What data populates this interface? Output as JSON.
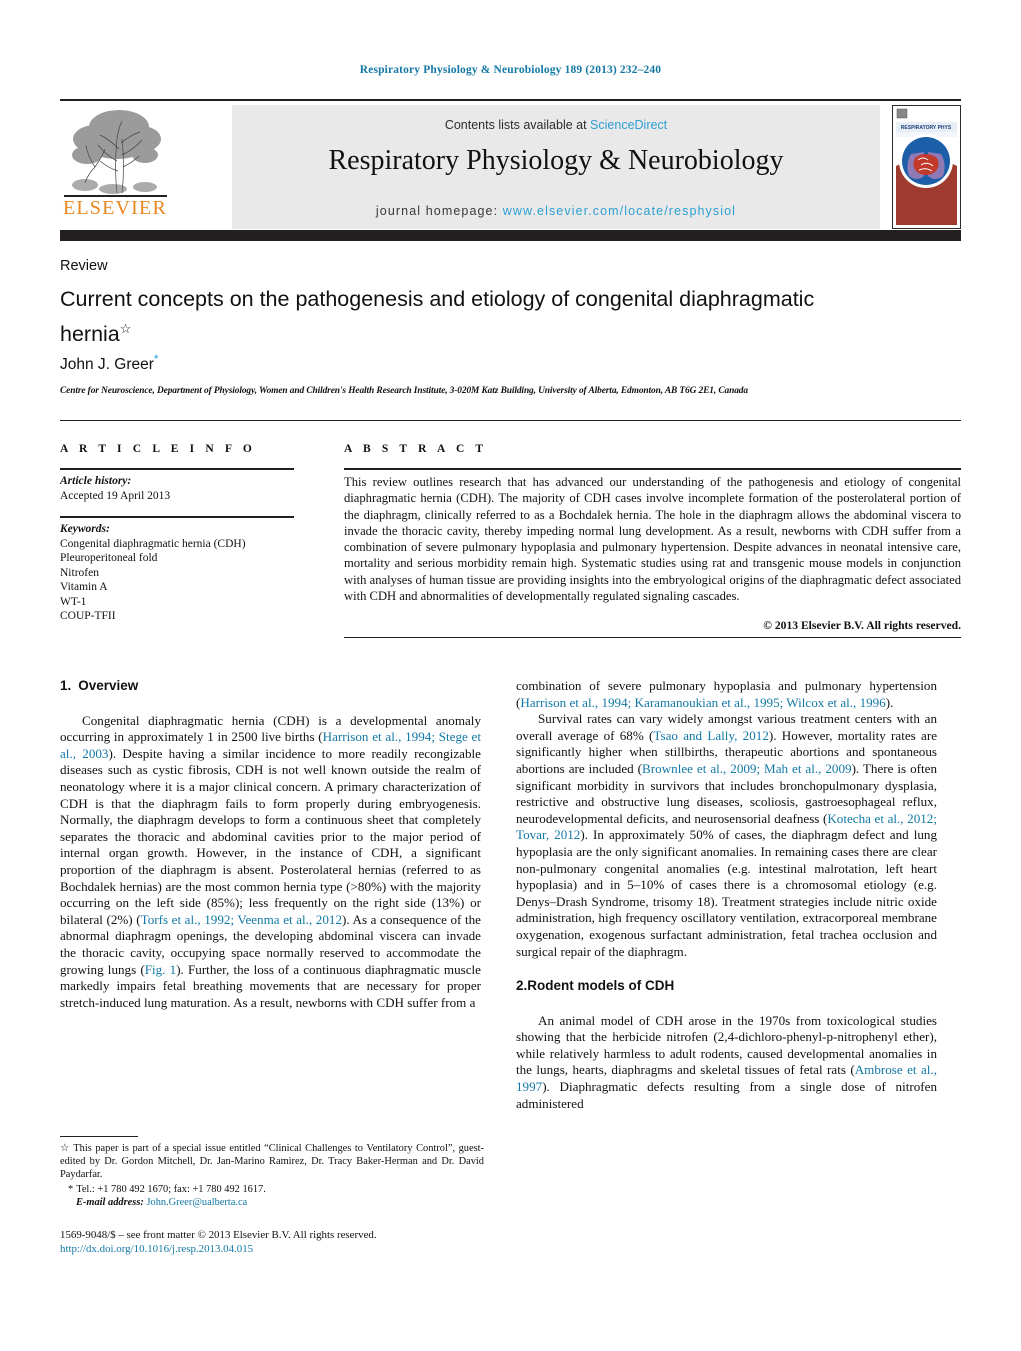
{
  "running_head": "Respiratory Physiology & Neurobiology 189 (2013) 232–240",
  "masthead": {
    "contents_prefix": "Contents lists available at ",
    "contents_link": "ScienceDirect",
    "journal_name": "Respiratory Physiology & Neurobiology",
    "homepage_label": "journal homepage: ",
    "homepage_url": "www.elsevier.com/locate/resphysiol",
    "publisher_logo_text": "ELSEVIER",
    "publisher_logo_icon": "elsevier-tree-icon",
    "cover_thumbnail_icon": "journal-cover-thumbnail",
    "cover_title_text": "RESPIRATORY PHYSIOLOGY & NEUROBIOLOGY",
    "accent_link_color": "#2e9fd4",
    "band_color": "#231f20"
  },
  "article": {
    "doctype": "Review",
    "title": "Current concepts on the pathogenesis and etiology of congenital diaphragmatic hernia",
    "title_marker": "☆",
    "author": "John J. Greer",
    "author_marker": "*",
    "affiliation": "Centre for Neuroscience, Department of Physiology, Women and Children's Health Research Institute, 3-020M Katz Building, University of Alberta, Edmonton, AB T6G 2E1, Canada"
  },
  "article_info": {
    "heading": "A R T I C L E   I N F O",
    "history_label": "Article history:",
    "history_value": "Accepted 19 April 2013",
    "keywords_label": "Keywords:",
    "keywords": [
      "Congenital diaphragmatic hernia (CDH)",
      "Pleuroperitoneal fold",
      "Nitrofen",
      "Vitamin A",
      "WT-1",
      "COUP-TFII"
    ]
  },
  "abstract": {
    "heading": "A B S T R A C T",
    "body": "This review outlines research that has advanced our understanding of the pathogenesis and etiology of congenital diaphragmatic hernia (CDH). The majority of CDH cases involve incomplete formation of the posterolateral portion of the diaphragm, clinically referred to as a Bochdalek hernia. The hole in the diaphragm allows the abdominal viscera to invade the thoracic cavity, thereby impeding normal lung development. As a result, newborns with CDH suffer from a combination of severe pulmonary hypoplasia and pulmonary hypertension. Despite advances in neonatal intensive care, mortality and serious morbidity remain high. Systematic studies using rat and transgenic mouse models in conjunction with analyses of human tissue are providing insights into the embryological origins of the diaphragmatic defect associated with CDH and abnormalities of developmentally regulated signaling cascades.",
    "copyright": "© 2013 Elsevier B.V. All rights reserved."
  },
  "sections": {
    "overview": {
      "number": "1.",
      "title": "Overview",
      "p1_a": "Congenital diaphragmatic hernia (CDH) is a developmental anomaly occurring in approximately 1 in 2500 live births (",
      "p1_ref1": "Harrison et al., 1994; Stege et al., 2003",
      "p1_b": "). Despite having a similar incidence to more readily recongizable diseases such as cystic fibrosis, CDH is not well known outside the realm of neonatology where it is a major clinical concern. A primary characterization of CDH is that the diaphragm fails to form properly during embryogenesis. Normally, the diaphragm develops to form a continuous sheet that completely separates the thoracic and abdominal cavities prior to the major period of internal organ growth. However, in the instance of CDH, a significant proportion of the diaphragm is absent. Posterolateral hernias (referred to as Bochdalek hernias) are the most common hernia type (>80%) with the majority occurring on the left side (85%); less frequently on the right side (13%) or bilateral (2%) (",
      "p1_ref2": "Torfs et al., 1992; Veenma et al., 2012",
      "p1_c": "). As a consequence of the abnormal diaphragm openings, the developing abdominal viscera can invade the thoracic cavity, occupying space normally reserved to accommodate the growing lungs (",
      "p1_ref3": "Fig. 1",
      "p1_d": "). Further, the loss of a continuous diaphragmatic muscle markedly impairs fetal breathing movements that are necessary for proper stretch-induced lung maturation. As a result, newborns with CDH suffer from a ",
      "p1_cont_a": "combination of severe pulmonary hypoplasia and pulmonary hypertension (",
      "p1_cont_ref": "Harrison et al., 1994; Karamanoukian et al., 1995; Wilcox et al., 1996",
      "p1_cont_b": ").",
      "p2_a": "Survival rates can vary widely amongst various treatment centers with an overall average of 68% (",
      "p2_ref1": "Tsao and Lally, 2012",
      "p2_b": "). However, mortality rates are significantly higher when stillbirths, therapeutic abortions and spontaneous abortions are included (",
      "p2_ref2": "Brownlee et al., 2009; Mah et al., 2009",
      "p2_c": "). There is often significant morbidity in survivors that includes bronchopulmonary dysplasia, restrictive and obstructive lung diseases, scoliosis, gastroesophageal reflux, neurodevelopmental deficits, and neurosensorial deafness (",
      "p2_ref3": "Kotecha et al., 2012; Tovar, 2012",
      "p2_d": "). In approximately 50% of cases, the diaphragm defect and lung hypoplasia are the only significant anomalies. In remaining cases there are clear non-pulmonary congenital anomalies (e.g. intestinal malrotation, left heart hypoplasia) and in 5–10% of cases there is a chromosomal etiology (e.g. Denys–Drash Syndrome, trisomy 18). Treatment strategies include nitric oxide administration, high frequency oscillatory ventilation, extracorporeal membrane oxygenation, exogenous surfactant administration, fetal trachea occlusion and surgical repair of the diaphragm."
    },
    "rodent": {
      "number": "2.",
      "title": "Rodent models of CDH",
      "p1_a": "An animal model of CDH arose in the 1970s from toxicological studies showing that the herbicide nitrofen (2,4-dichloro-phenyl-p-nitrophenyl ether), while relatively harmless to adult rodents, caused developmental anomalies in the lungs, hearts, diaphragms and skeletal tissues of fetal rats (",
      "p1_ref1": "Ambrose et al., 1997",
      "p1_b": "). Diaphragmatic defects resulting from a single dose of nitrofen administered"
    }
  },
  "footnotes": {
    "star_symbol": "☆",
    "special_issue": "This paper is part of a special issue entitled “Clinical Challenges to Ventilatory Control”, guest-edited by Dr. Gordon Mitchell, Dr. Jan-Marino Ramirez, Dr. Tracy Baker-Herman and Dr. David Paydarfar.",
    "corresponding_symbol": "*",
    "tel": "Tel.: +1 780 492 1670; fax: +1 780 492 1617.",
    "email_label": "E-mail address:",
    "email": "John.Greer@ualberta.ca"
  },
  "frontmatter": {
    "line1": "1569-9048/$ – see front matter © 2013 Elsevier B.V. All rights reserved.",
    "doi": "http://dx.doi.org/10.1016/j.resp.2013.04.015"
  }
}
